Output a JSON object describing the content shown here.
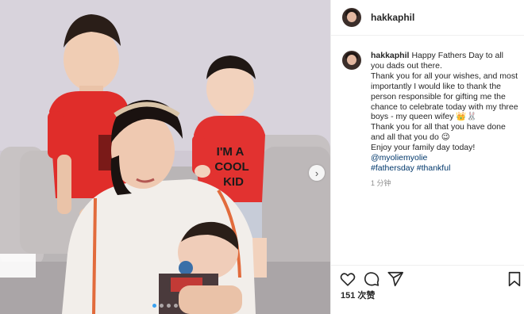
{
  "post": {
    "username": "hakkaphil",
    "caption": {
      "lines": [
        "Happy Fathers Day to all you dads out there.",
        "Thank you for all your wishes, and most importantly I would like to thank the person responsible for gifting me the chance to celebrate today with my three boys - my queen wifey 👑🐰",
        "Thank you for all that you have done and all that you do 😉",
        "Enjoy your family day today!"
      ],
      "mention": "@myoliemyolie",
      "hashtags": "#fathersday #thankful"
    },
    "time_ago": "1 分钟",
    "likes": "151 次赞",
    "photo": {
      "shirt_text_1": "I'M A",
      "shirt_text_2": "COOL",
      "shirt_text_3": "KID"
    },
    "carousel": {
      "count": 4,
      "active": 1,
      "next_icon": "chevron-right-icon"
    },
    "icons": [
      "heart-icon",
      "comment-icon",
      "share-icon",
      "bookmark-icon"
    ]
  }
}
